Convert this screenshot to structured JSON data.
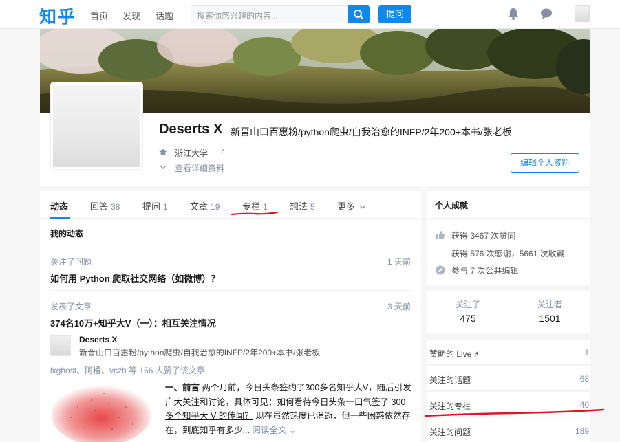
{
  "header": {
    "logo": "知乎",
    "nav": [
      "首页",
      "发现",
      "话题"
    ],
    "search_placeholder": "搜索你感兴趣的内容...",
    "ask_label": "提问"
  },
  "profile": {
    "name": "Deserts X",
    "headline": "新晋山口百惠粉/python爬虫/自我治愈的INFP/2年200+本书/张老板",
    "school": "浙江大学",
    "gender_symbol": "♂",
    "details_link": "查看详细资料",
    "edit_label": "编辑个人资料"
  },
  "tabs": [
    {
      "label": "动态",
      "count": ""
    },
    {
      "label": "回答",
      "count": "38"
    },
    {
      "label": "提问",
      "count": "1"
    },
    {
      "label": "文章",
      "count": "19"
    },
    {
      "label": "专栏",
      "count": "1"
    },
    {
      "label": "想法",
      "count": "5"
    },
    {
      "label": "更多",
      "count": ""
    }
  ],
  "feed": {
    "section_title": "我的动态",
    "items": [
      {
        "action": "关注了问题",
        "time": "1 天前",
        "title": "如何用 Python 爬取社交网络（如微博）？"
      },
      {
        "action": "发表了文章",
        "time": "3 天前",
        "title": "374名10万+知乎大V（一）：相互关注情况"
      }
    ],
    "article": {
      "author_name": "Deserts X",
      "author_desc": "新晋山口百惠粉/python爬虫/自我治愈的INFP/2年200+本书/张老板",
      "likers": "lxghost、阿橙、vczh 等 156 人赞了该文章",
      "excerpt_bold": "一、前言",
      "excerpt_a": " 两个月前，今日头条签约了300多名知乎大V，随后引发广大关注和讨论，具体可见：",
      "excerpt_link": "如何看待今日头条一口气签了 300 多个知乎大 V 的传闻？",
      "excerpt_b": " 现在虽然热度已消逝，但一些困惑依然存在，到底知乎有多少...",
      "read_more": "阅读全文"
    }
  },
  "sidebar": {
    "achievements_title": "个人成就",
    "achievements": [
      "获得 3467 次赞同",
      "获得 576 次感谢，5661 次收藏",
      "参与 7 次公共编辑"
    ],
    "following_label": "关注了",
    "following_count": "475",
    "followers_label": "关注者",
    "followers_count": "1501",
    "lists": [
      {
        "label": "赞助的 Live ⚡",
        "count": "1"
      },
      {
        "label": "关注的话题",
        "count": "68"
      },
      {
        "label": "关注的专栏",
        "count": "40"
      },
      {
        "label": "关注的问题",
        "count": "189"
      }
    ]
  },
  "colors": {
    "accent": "#0f88eb",
    "annotation_red": "#e0151f"
  }
}
